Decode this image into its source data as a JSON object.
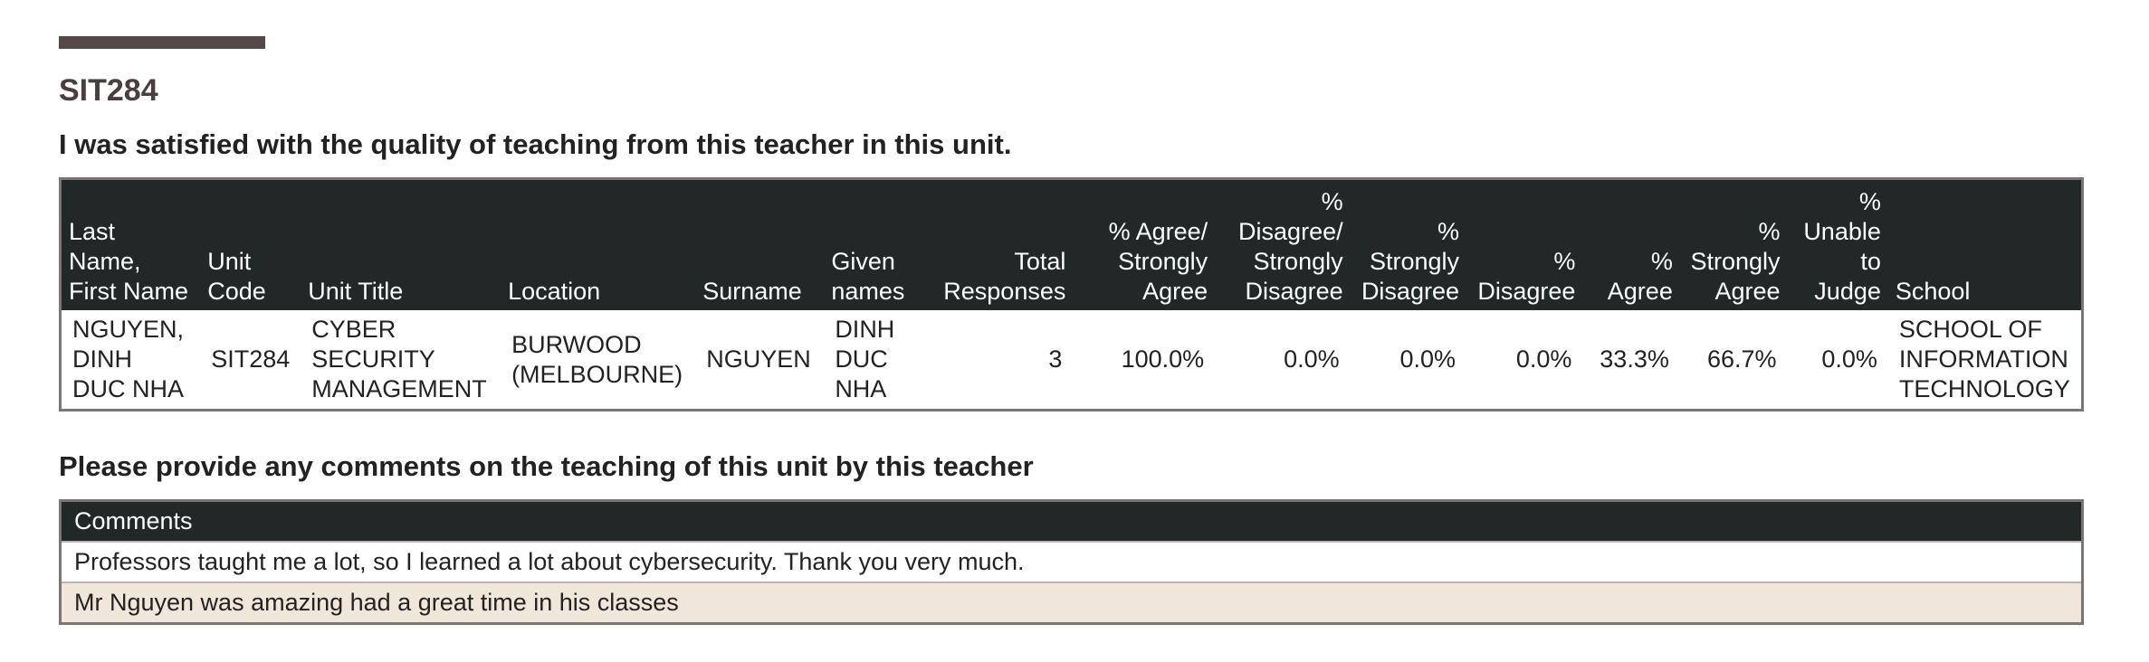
{
  "unit_code_heading": "SIT284",
  "question": "I was satisfied with the quality of teaching from this teacher in this unit.",
  "results_table": {
    "headers": [
      "Last Name, First Name",
      "Unit Code",
      "Unit Title",
      "Location",
      "Surname",
      "Given names",
      "Total Responses",
      "% Agree/ Strongly Agree",
      "% Disagree/ Strongly Disagree",
      "% Strongly Disagree",
      "% Disagree",
      "% Agree",
      "% Strongly Agree",
      "% Unable to Judge",
      "School"
    ],
    "row": {
      "name": "NGUYEN, DINH DUC NHA",
      "unit_code": "SIT284",
      "unit_title": "CYBER SECURITY MANAGEMENT",
      "location": "BURWOOD (MELBOURNE)",
      "surname": "NGUYEN",
      "given_names": "DINH DUC NHA",
      "total_responses": "3",
      "pct_agree_strongly_agree": "100.0%",
      "pct_disagree_strongly_disagree": "0.0%",
      "pct_strongly_disagree": "0.0%",
      "pct_disagree": "0.0%",
      "pct_agree": "33.3%",
      "pct_strongly_agree": "66.7%",
      "pct_unable_to_judge": "0.0%",
      "school": "SCHOOL OF INFORMATION TECHNOLOGY"
    }
  },
  "comments_heading": "Please provide any comments on the teaching of this unit by this teacher",
  "comments_table": {
    "header": "Comments",
    "items": [
      "Professors taught me a lot, so I learned a lot about cybersecurity. Thank you very much.",
      "Mr Nguyen was amazing had a great time in his classes"
    ]
  },
  "colors": {
    "header_bg": "#222728",
    "accent_bar": "#564848",
    "alt_row_bg": "#f0e6da",
    "border": "#7d7474"
  }
}
